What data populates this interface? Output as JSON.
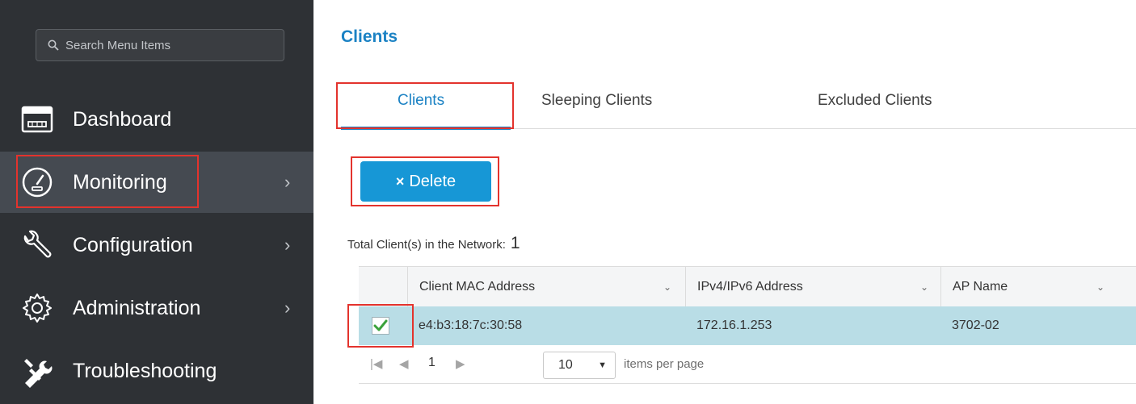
{
  "sidebar": {
    "search_placeholder": "Search Menu Items",
    "items": [
      {
        "label": "Dashboard",
        "icon": "dashboard-icon",
        "chevron": ""
      },
      {
        "label": "Monitoring",
        "icon": "gauge-icon",
        "chevron": "›"
      },
      {
        "label": "Configuration",
        "icon": "wrench-icon",
        "chevron": "›"
      },
      {
        "label": "Administration",
        "icon": "gear-icon",
        "chevron": "›"
      },
      {
        "label": "Troubleshooting",
        "icon": "tools-icon",
        "chevron": ""
      }
    ]
  },
  "main": {
    "title": "Clients",
    "tabs": [
      {
        "label": "Clients",
        "active": true
      },
      {
        "label": "Sleeping Clients",
        "active": false
      },
      {
        "label": "Excluded Clients",
        "active": false
      }
    ],
    "delete_icon": "×",
    "delete_label": "Delete",
    "total_label": "Total Client(s) in the Network:",
    "total_count": "1",
    "columns": [
      "Client MAC Address",
      "IPv4/IPv6 Address",
      "AP Name"
    ],
    "column_caret": "⌄",
    "rows": [
      {
        "mac": "e4:b3:18:7c:30:58",
        "ip": "172.16.1.253",
        "ap": "3702-02",
        "checked": true
      }
    ],
    "pager": {
      "first": "|◀",
      "prev": "◀",
      "page": "1",
      "next": "▶",
      "per_page": "10",
      "per_page_label": "items per page"
    }
  },
  "colors": {
    "sidebar_bg": "#2e3135",
    "accent": "#1b82c4",
    "button": "#1797d6",
    "selected_row": "#b9dde6",
    "highlight": "#e3332d"
  }
}
